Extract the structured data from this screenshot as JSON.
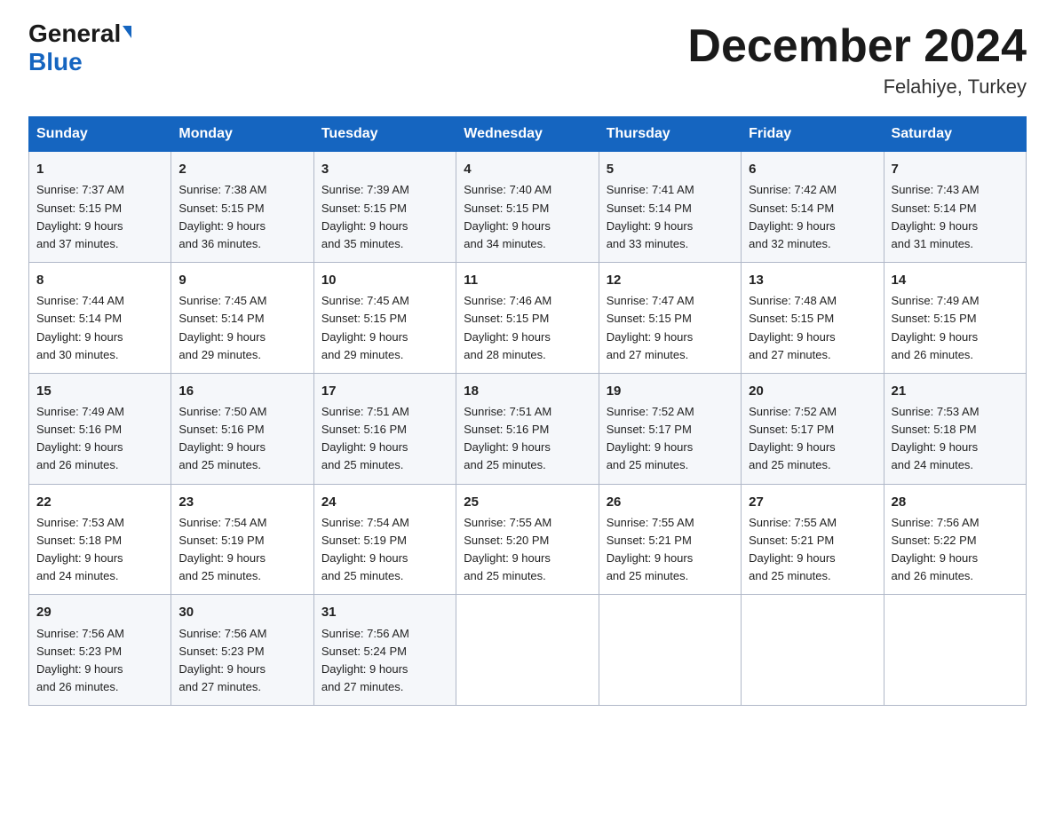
{
  "logo": {
    "line1_general": "General",
    "line1_triangle": true,
    "line2": "Blue"
  },
  "title": "December 2024",
  "subtitle": "Felahiye, Turkey",
  "weekdays": [
    "Sunday",
    "Monday",
    "Tuesday",
    "Wednesday",
    "Thursday",
    "Friday",
    "Saturday"
  ],
  "weeks": [
    [
      {
        "day": "1",
        "sunrise": "7:37 AM",
        "sunset": "5:15 PM",
        "daylight": "9 hours and 37 minutes."
      },
      {
        "day": "2",
        "sunrise": "7:38 AM",
        "sunset": "5:15 PM",
        "daylight": "9 hours and 36 minutes."
      },
      {
        "day": "3",
        "sunrise": "7:39 AM",
        "sunset": "5:15 PM",
        "daylight": "9 hours and 35 minutes."
      },
      {
        "day": "4",
        "sunrise": "7:40 AM",
        "sunset": "5:15 PM",
        "daylight": "9 hours and 34 minutes."
      },
      {
        "day": "5",
        "sunrise": "7:41 AM",
        "sunset": "5:14 PM",
        "daylight": "9 hours and 33 minutes."
      },
      {
        "day": "6",
        "sunrise": "7:42 AM",
        "sunset": "5:14 PM",
        "daylight": "9 hours and 32 minutes."
      },
      {
        "day": "7",
        "sunrise": "7:43 AM",
        "sunset": "5:14 PM",
        "daylight": "9 hours and 31 minutes."
      }
    ],
    [
      {
        "day": "8",
        "sunrise": "7:44 AM",
        "sunset": "5:14 PM",
        "daylight": "9 hours and 30 minutes."
      },
      {
        "day": "9",
        "sunrise": "7:45 AM",
        "sunset": "5:14 PM",
        "daylight": "9 hours and 29 minutes."
      },
      {
        "day": "10",
        "sunrise": "7:45 AM",
        "sunset": "5:15 PM",
        "daylight": "9 hours and 29 minutes."
      },
      {
        "day": "11",
        "sunrise": "7:46 AM",
        "sunset": "5:15 PM",
        "daylight": "9 hours and 28 minutes."
      },
      {
        "day": "12",
        "sunrise": "7:47 AM",
        "sunset": "5:15 PM",
        "daylight": "9 hours and 27 minutes."
      },
      {
        "day": "13",
        "sunrise": "7:48 AM",
        "sunset": "5:15 PM",
        "daylight": "9 hours and 27 minutes."
      },
      {
        "day": "14",
        "sunrise": "7:49 AM",
        "sunset": "5:15 PM",
        "daylight": "9 hours and 26 minutes."
      }
    ],
    [
      {
        "day": "15",
        "sunrise": "7:49 AM",
        "sunset": "5:16 PM",
        "daylight": "9 hours and 26 minutes."
      },
      {
        "day": "16",
        "sunrise": "7:50 AM",
        "sunset": "5:16 PM",
        "daylight": "9 hours and 25 minutes."
      },
      {
        "day": "17",
        "sunrise": "7:51 AM",
        "sunset": "5:16 PM",
        "daylight": "9 hours and 25 minutes."
      },
      {
        "day": "18",
        "sunrise": "7:51 AM",
        "sunset": "5:16 PM",
        "daylight": "9 hours and 25 minutes."
      },
      {
        "day": "19",
        "sunrise": "7:52 AM",
        "sunset": "5:17 PM",
        "daylight": "9 hours and 25 minutes."
      },
      {
        "day": "20",
        "sunrise": "7:52 AM",
        "sunset": "5:17 PM",
        "daylight": "9 hours and 25 minutes."
      },
      {
        "day": "21",
        "sunrise": "7:53 AM",
        "sunset": "5:18 PM",
        "daylight": "9 hours and 24 minutes."
      }
    ],
    [
      {
        "day": "22",
        "sunrise": "7:53 AM",
        "sunset": "5:18 PM",
        "daylight": "9 hours and 24 minutes."
      },
      {
        "day": "23",
        "sunrise": "7:54 AM",
        "sunset": "5:19 PM",
        "daylight": "9 hours and 25 minutes."
      },
      {
        "day": "24",
        "sunrise": "7:54 AM",
        "sunset": "5:19 PM",
        "daylight": "9 hours and 25 minutes."
      },
      {
        "day": "25",
        "sunrise": "7:55 AM",
        "sunset": "5:20 PM",
        "daylight": "9 hours and 25 minutes."
      },
      {
        "day": "26",
        "sunrise": "7:55 AM",
        "sunset": "5:21 PM",
        "daylight": "9 hours and 25 minutes."
      },
      {
        "day": "27",
        "sunrise": "7:55 AM",
        "sunset": "5:21 PM",
        "daylight": "9 hours and 25 minutes."
      },
      {
        "day": "28",
        "sunrise": "7:56 AM",
        "sunset": "5:22 PM",
        "daylight": "9 hours and 26 minutes."
      }
    ],
    [
      {
        "day": "29",
        "sunrise": "7:56 AM",
        "sunset": "5:23 PM",
        "daylight": "9 hours and 26 minutes."
      },
      {
        "day": "30",
        "sunrise": "7:56 AM",
        "sunset": "5:23 PM",
        "daylight": "9 hours and 27 minutes."
      },
      {
        "day": "31",
        "sunrise": "7:56 AM",
        "sunset": "5:24 PM",
        "daylight": "9 hours and 27 minutes."
      },
      null,
      null,
      null,
      null
    ]
  ],
  "labels": {
    "sunrise": "Sunrise:",
    "sunset": "Sunset:",
    "daylight": "Daylight:"
  }
}
